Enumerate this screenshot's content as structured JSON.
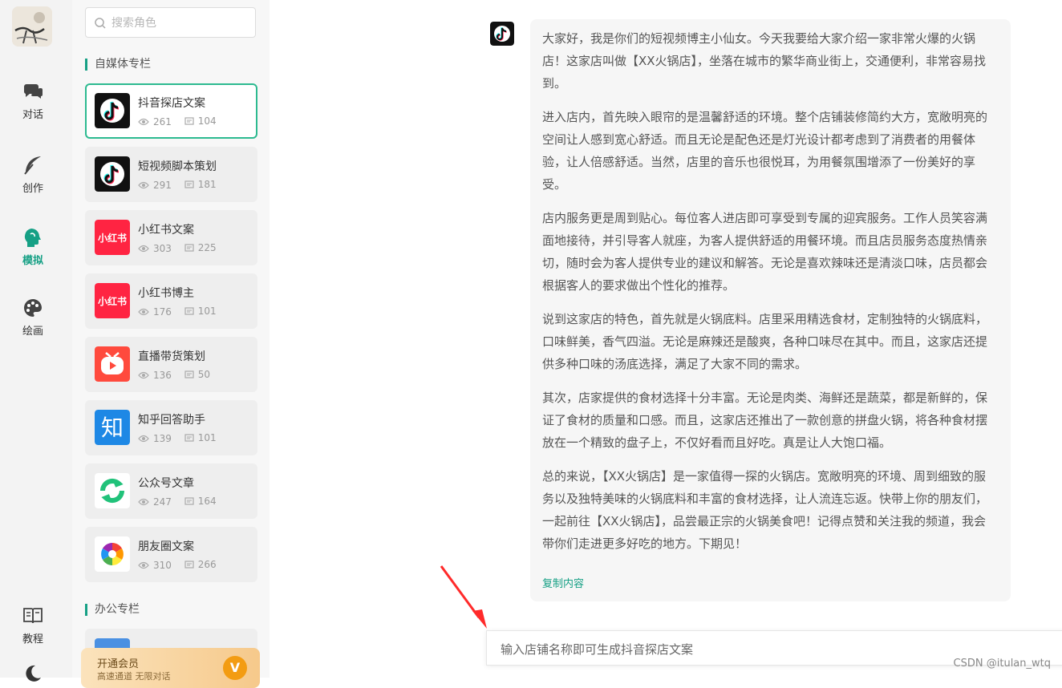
{
  "nav": {
    "items": [
      {
        "label": "对话",
        "icon": "chat-bubbles-icon"
      },
      {
        "label": "创作",
        "icon": "feather-icon"
      },
      {
        "label": "模拟",
        "icon": "head-profile-icon",
        "active": true
      },
      {
        "label": "绘画",
        "icon": "palette-icon"
      },
      {
        "label": "教程",
        "icon": "book-icon"
      }
    ],
    "active_color": "#16a085"
  },
  "search": {
    "placeholder": "搜索角色"
  },
  "sections": [
    {
      "title": "自媒体专栏"
    },
    {
      "title": "办公专栏"
    }
  ],
  "characters": [
    {
      "name": "抖音探店文案",
      "views": "261",
      "comments": "104",
      "logo": "douyin-logo",
      "selected": true
    },
    {
      "name": "短视频脚本策划",
      "views": "291",
      "comments": "181",
      "logo": "douyin-logo"
    },
    {
      "name": "小红书文案",
      "views": "303",
      "comments": "225",
      "logo": "xiaohongshu-logo",
      "logo_text": "小红书"
    },
    {
      "name": "小红书博主",
      "views": "176",
      "comments": "101",
      "logo": "xiaohongshu-logo",
      "logo_text": "小红书"
    },
    {
      "name": "直播带货策划",
      "views": "136",
      "comments": "50",
      "logo": "live-stream-logo"
    },
    {
      "name": "知乎回答助手",
      "views": "139",
      "comments": "101",
      "logo": "zhihu-logo",
      "logo_text": "知"
    },
    {
      "name": "公众号文章",
      "views": "247",
      "comments": "164",
      "logo": "wechat-official-logo"
    },
    {
      "name": "朋友圈文案",
      "views": "310",
      "comments": "266",
      "logo": "moments-aperture-logo"
    }
  ],
  "vip": {
    "title": "开通会员",
    "subtitle": "高速通道 无限对话",
    "badge": "V"
  },
  "message": {
    "paragraphs": [
      "大家好，我是你们的短视频博主小仙女。今天我要给大家介绍一家非常火爆的火锅店！这家店叫做【XX火锅店】，坐落在城市的繁华商业街上，交通便利，非常容易找到。",
      "进入店内，首先映入眼帘的是温馨舒适的环境。整个店铺装修简约大方，宽敞明亮的空间让人感到宽心舒适。而且无论是配色还是灯光设计都考虑到了消费者的用餐体验，让人倍感舒适。当然，店里的音乐也很悦耳，为用餐氛围增添了一份美好的享受。",
      "店内服务更是周到贴心。每位客人进店即可享受到专属的迎宾服务。工作人员笑容满面地接待，并引导客人就座，为客人提供舒适的用餐环境。而且店员服务态度热情亲切，随时会为客人提供专业的建议和解答。无论是喜欢辣味还是清淡口味，店员都会根据客人的要求做出个性化的推荐。",
      "说到这家店的特色，首先就是火锅底料。店里采用精选食材，定制独特的火锅底料，口味鲜美，香气四溢。无论是麻辣还是酸爽，各种口味尽在其中。而且，这家店还提供多种口味的汤底选择，满足了大家不同的需求。",
      "其次，店家提供的食材选择十分丰富。无论是肉类、海鲜还是蔬菜，都是新鲜的，保证了食材的质量和口感。而且，这家店还推出了一款创意的拼盘火锅，将各种食材摆放在一个精致的盘子上，不仅好看而且好吃。真是让人大饱口福。",
      "总的来说，【XX火锅店】是一家值得一探的火锅店。宽敞明亮的环境、周到细致的服务以及独特美味的火锅底料和丰富的食材选择，让人流连忘返。快带上你的朋友们，一起前往【XX火锅店】，品尝最正宗的火锅美食吧！记得点赞和关注我的频道，我会带你们走进更多好吃的地方。下期见！"
    ],
    "copy_label": "复制内容"
  },
  "composer": {
    "placeholder": "输入店铺名称即可生成抖音探店文案"
  },
  "watermark": "CSDN @itulan_wtq",
  "annotation": {
    "color": "#ff2a2a"
  }
}
